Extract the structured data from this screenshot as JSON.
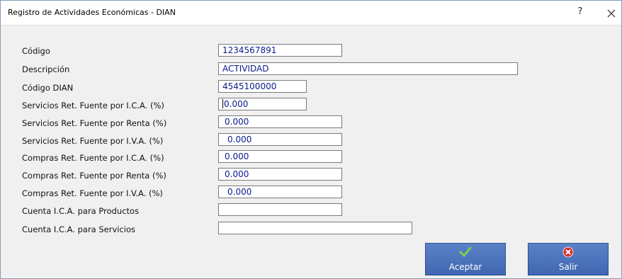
{
  "window": {
    "title": "Registro de Actividades Económicas - DIAN",
    "help_label": "?"
  },
  "form": {
    "fields": [
      {
        "label": "Código",
        "value": "1234567891"
      },
      {
        "label": "Descripción",
        "value": "ACTIVIDAD"
      },
      {
        "label": "Código DIAN",
        "value": "4545100000"
      },
      {
        "label": "Servicios Ret. Fuente por I.C.A. (%)",
        "value": "0.000"
      },
      {
        "label": "Servicios Ret. Fuente por Renta  (%)",
        "value": "0.000"
      },
      {
        "label": "Servicios Ret. Fuente por I.V.A. (%)",
        "value": "0.000"
      },
      {
        "label": "Compras Ret. Fuente por I.C.A. (%)",
        "value": "0.000"
      },
      {
        "label": "Compras Ret. Fuente por Renta  (%)",
        "value": "0.000"
      },
      {
        "label": "Compras Ret. Fuente por I.V.A. (%)",
        "value": "0.000"
      },
      {
        "label": "Cuenta I.C.A. para Productos",
        "value": ""
      },
      {
        "label": "Cuenta I.C.A. para Servicios",
        "value": ""
      }
    ]
  },
  "buttons": {
    "accept_label": "Aceptar",
    "exit_label": "Salir"
  },
  "colors": {
    "button_bg": "#4a71bb",
    "value_text": "#0a1a8c",
    "accept_icon": "#6cc04a",
    "exit_icon": "#d9302c"
  },
  "icons": {
    "close": "close-icon",
    "accept": "checkmark-icon",
    "exit": "exit-x-icon"
  }
}
